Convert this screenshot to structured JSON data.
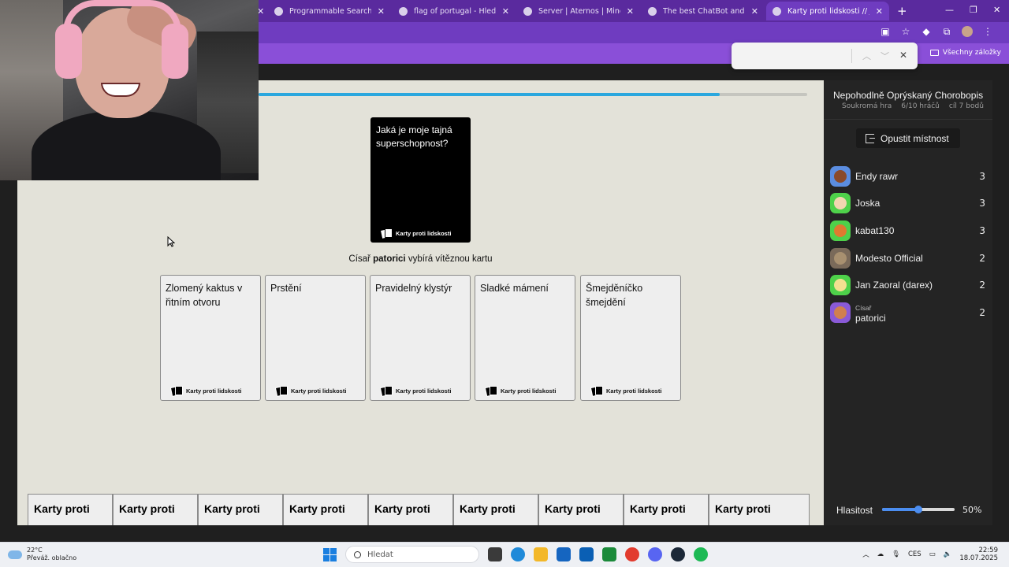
{
  "browser": {
    "tabs": [
      {
        "title": "Programmable Search Engine",
        "active": false
      },
      {
        "title": "flag of portugal - Hledat Goog",
        "active": false
      },
      {
        "title": "Server | Aternos | Minecraft Ser",
        "active": false
      },
      {
        "title": "The best ChatBot and Widgets",
        "active": false
      },
      {
        "title": "Karty proti lidskosti // Jakub Hy",
        "active": true
      }
    ],
    "bookmarks_label": "Všechny záložky"
  },
  "game": {
    "progress_fraction": 0.84,
    "black_card": {
      "question": "Jaká je moje tajná superschopnost?",
      "brand": "Karty proti lidskosti"
    },
    "status": {
      "prefix": "Císař ",
      "czar": "patorici",
      "suffix": " vybírá vítěznou kartu"
    },
    "white_cards": [
      {
        "text": "Zlomený kaktus v řitním otvoru",
        "brand": "Karty proti lidskosti"
      },
      {
        "text": "Prstění",
        "brand": "Karty proti lidskosti"
      },
      {
        "text": "Pravidelný klystýr",
        "brand": "Karty proti lidskosti"
      },
      {
        "text": "Sladké mámení",
        "brand": "Karty proti lidskosti"
      },
      {
        "text": "Šmejděníčko šmejdění",
        "brand": "Karty proti lidskosti"
      }
    ],
    "hand_cards": [
      "Karty proti",
      "Karty proti",
      "Karty proti",
      "Karty proti",
      "Karty proti",
      "Karty proti",
      "Karty proti",
      "Karty proti",
      "Karty proti"
    ]
  },
  "sidebar": {
    "room_title": "Nepohodlně Oprýskaný Chorobopis",
    "meta": {
      "type": "Soukromá hra",
      "players": "6/10 hráčů",
      "goal": "cíl 7 bodů"
    },
    "leave_label": "Opustit místnost",
    "players": [
      {
        "name": "Endy rawr",
        "score": "3",
        "role": "",
        "avatar_bg": "#5b8de0",
        "face": "#8a4a2a"
      },
      {
        "name": "Joska",
        "score": "3",
        "role": "",
        "avatar_bg": "#4ed14a",
        "face": "#f2d6b0"
      },
      {
        "name": "kabat130",
        "score": "3",
        "role": "",
        "avatar_bg": "#4ed14a",
        "face": "#e07a30"
      },
      {
        "name": "Modesto Official",
        "score": "2",
        "role": "",
        "avatar_bg": "#7a6a5a",
        "face": "#a89070"
      },
      {
        "name": "Jan Zaoral (darex)",
        "score": "2",
        "role": "",
        "avatar_bg": "#4ed14a",
        "face": "#f2e090"
      },
      {
        "name": "patorici",
        "score": "2",
        "role": "Císař",
        "avatar_bg": "#8a5ad8",
        "face": "#d08050"
      }
    ],
    "volume": {
      "label": "Hlasitost",
      "value_label": "50%",
      "fraction": 0.5
    }
  },
  "taskbar": {
    "weather_temp": "22°C",
    "weather_desc": "Převáž. oblačno",
    "search_placeholder": "Hledat",
    "lang": "CES",
    "time": "22:59",
    "date": "18.07.2025"
  }
}
